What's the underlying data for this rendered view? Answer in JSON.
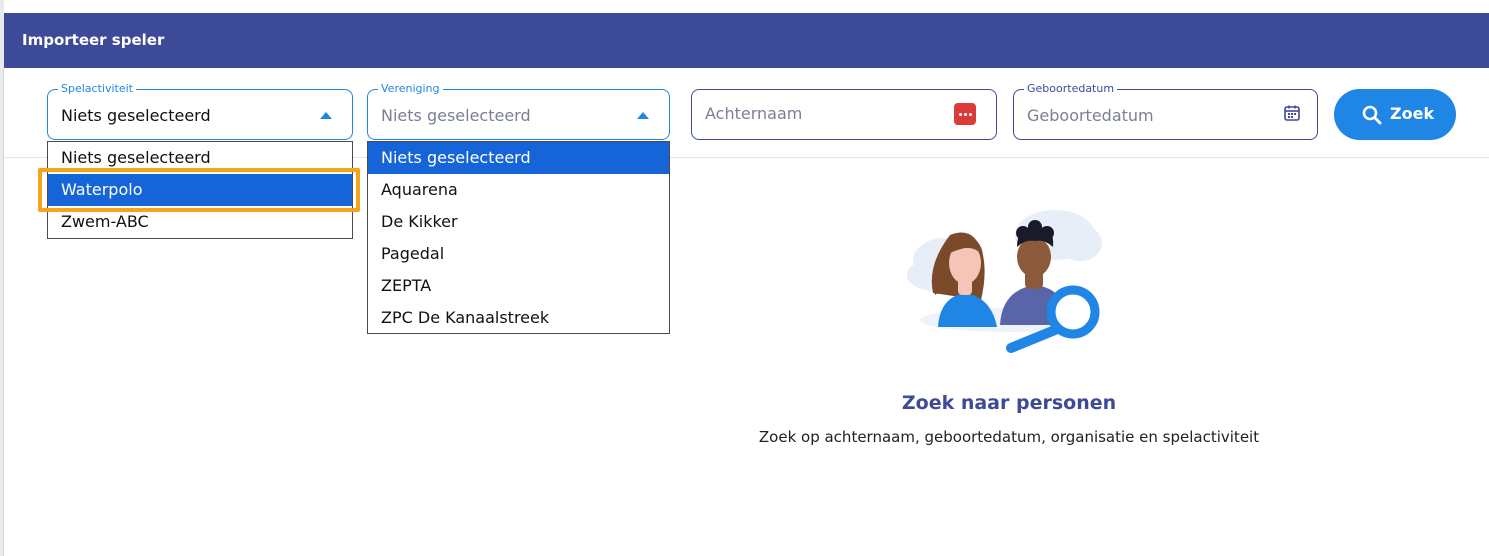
{
  "window": {
    "title": "Importeer speler"
  },
  "filters": {
    "spelactiviteit": {
      "label": "Spelactiviteit",
      "value": "Niets geselecteerd",
      "options": [
        "Niets geselecteerd",
        "Waterpolo",
        "Zwem-ABC"
      ],
      "highlighted": "Waterpolo"
    },
    "vereniging": {
      "label": "Vereniging",
      "value": "Niets geselecteerd",
      "options": [
        "Niets geselecteerd",
        "Aquarena",
        "De Kikker",
        "Pagedal",
        "ZEPTA",
        "ZPC De Kanaalstreek"
      ],
      "highlighted": "Niets geselecteerd"
    },
    "achternaam": {
      "placeholder": "Achternaam",
      "icon": "password-dots-icon"
    },
    "geboortedatum": {
      "label": "Geboortedatum",
      "placeholder": "Geboortedatum",
      "icon": "calendar-icon"
    }
  },
  "search_button": {
    "label": "Zoek",
    "icon": "search-icon"
  },
  "empty_state": {
    "title": "Zoek naar personen",
    "subtitle": "Zoek op achternaam, geboortedatum, organisatie en spelactiviteit",
    "illustration": "people-search-illustration"
  },
  "colors": {
    "header": "#3d4a98",
    "accent": "#1f86e6",
    "selected_option": "#1565d8",
    "highlight_outline": "#f5a31a"
  }
}
